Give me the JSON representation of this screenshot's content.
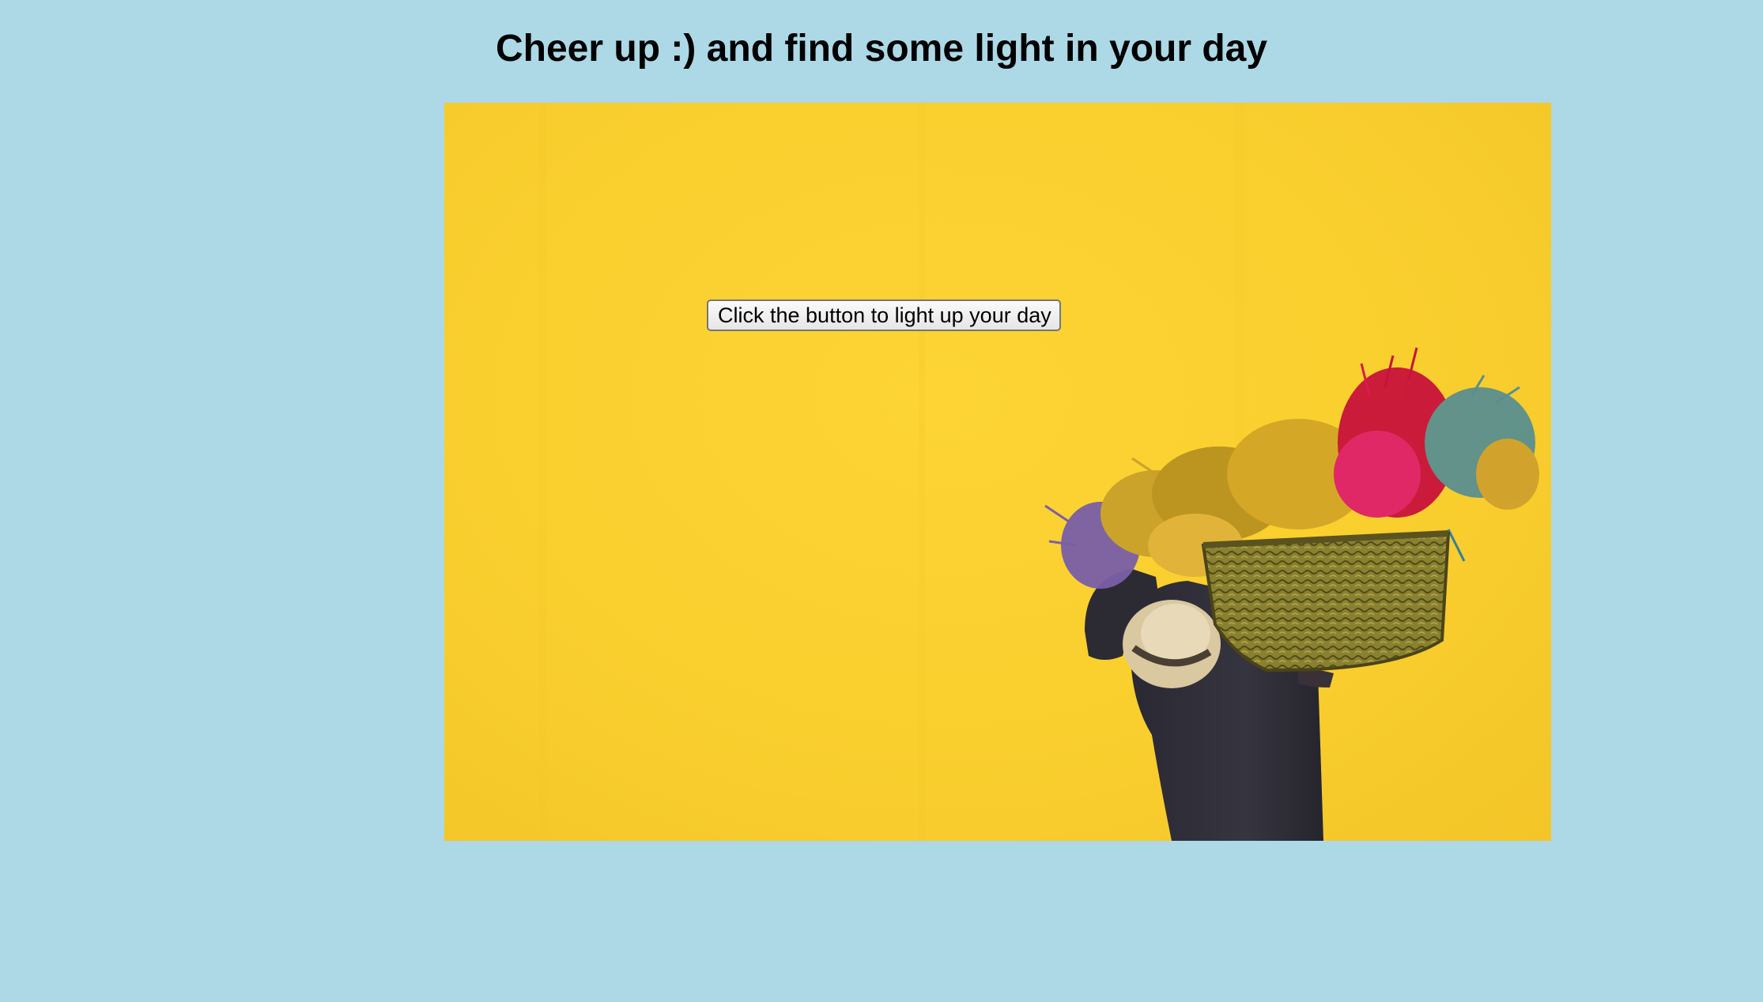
{
  "page": {
    "title": "Cheer up :) and find some light in your day",
    "background_color": "#add8e6"
  },
  "hero_image": {
    "subject": "person-carrying-basket-of-dried-flowers",
    "wall_color": "#fcd22f"
  },
  "button": {
    "label": "Click the button to light up your day"
  }
}
